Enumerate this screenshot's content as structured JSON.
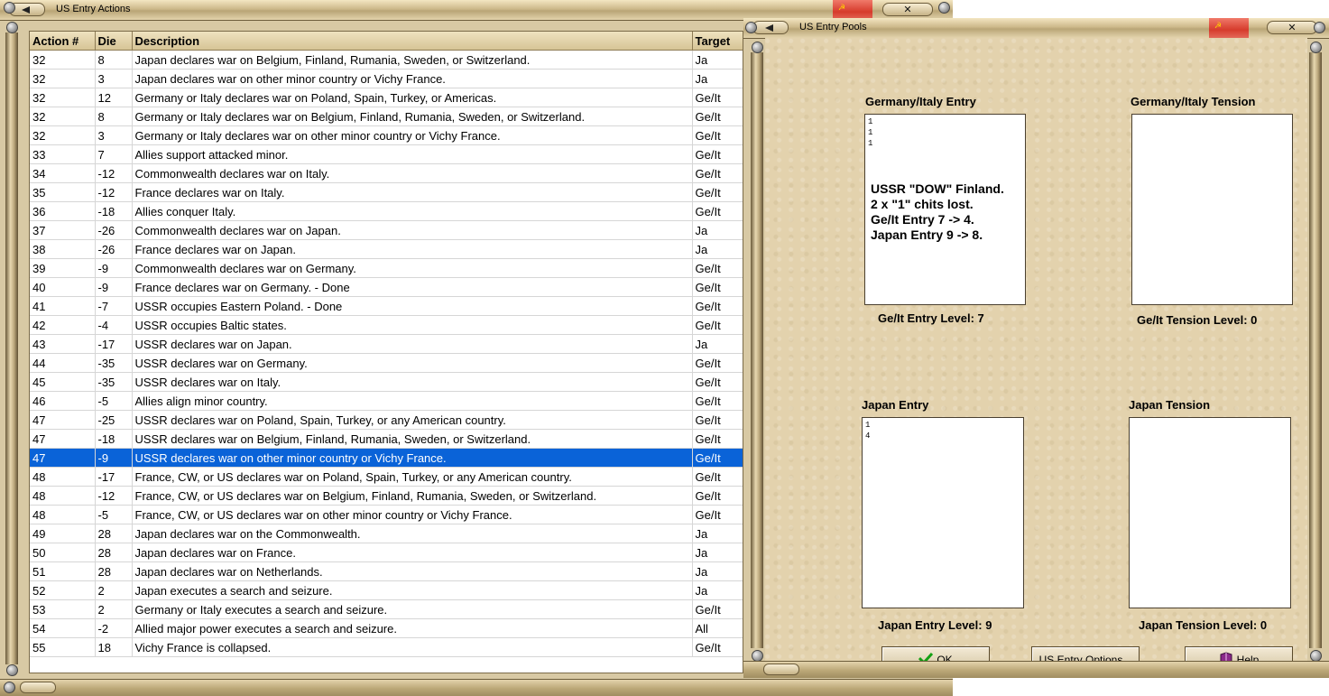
{
  "actions_window": {
    "title": "US Entry Actions",
    "columns": [
      "Action #",
      "Die",
      "Description",
      "Target"
    ],
    "selected_row": 21,
    "rows": [
      [
        "32",
        "8",
        "Japan declares war on Belgium, Finland, Rumania, Sweden, or Switzerland.",
        "Ja"
      ],
      [
        "32",
        "3",
        "Japan declares war on other minor country or Vichy France.",
        "Ja"
      ],
      [
        "32",
        "12",
        "Germany or Italy declares war on Poland, Spain, Turkey, or Americas.",
        "Ge/It"
      ],
      [
        "32",
        "8",
        "Germany or Italy declares war on Belgium, Finland, Rumania, Sweden, or Switzerland.",
        "Ge/It"
      ],
      [
        "32",
        "3",
        "Germany or Italy declares war on other minor country or Vichy France.",
        "Ge/It"
      ],
      [
        "33",
        "7",
        "Allies support attacked minor.",
        "Ge/It"
      ],
      [
        "34",
        "-12",
        "Commonwealth declares war on Italy.",
        "Ge/It"
      ],
      [
        "35",
        "-12",
        "France declares war on Italy.",
        "Ge/It"
      ],
      [
        "36",
        "-18",
        "Allies conquer Italy.",
        "Ge/It"
      ],
      [
        "37",
        "-26",
        "Commonwealth declares war on Japan.",
        "Ja"
      ],
      [
        "38",
        "-26",
        "France declares war on Japan.",
        "Ja"
      ],
      [
        "39",
        "-9",
        "Commonwealth declares war on Germany.",
        "Ge/It"
      ],
      [
        "40",
        "-9",
        "France declares war on Germany. - Done",
        "Ge/It"
      ],
      [
        "41",
        "-7",
        "USSR occupies Eastern Poland. - Done",
        "Ge/It"
      ],
      [
        "42",
        "-4",
        "USSR occupies Baltic states.",
        "Ge/It"
      ],
      [
        "43",
        "-17",
        "USSR declares war on Japan.",
        "Ja"
      ],
      [
        "44",
        "-35",
        "USSR declares war on Germany.",
        "Ge/It"
      ],
      [
        "45",
        "-35",
        "USSR declares war on Italy.",
        "Ge/It"
      ],
      [
        "46",
        "-5",
        "Allies align minor country.",
        "Ge/It"
      ],
      [
        "47",
        "-25",
        "USSR declares war on Poland, Spain, Turkey, or any American country.",
        "Ge/It"
      ],
      [
        "47",
        "-18",
        "USSR declares war on Belgium, Finland, Rumania, Sweden, or Switzerland.",
        "Ge/It"
      ],
      [
        "47",
        "-9",
        "USSR declares war on other minor country or Vichy France.",
        "Ge/It"
      ],
      [
        "48",
        "-17",
        "France, CW, or US declares war on Poland, Spain, Turkey, or any American country.",
        "Ge/It"
      ],
      [
        "48",
        "-12",
        "France, CW, or US declares war on Belgium, Finland, Rumania, Sweden, or Switzerland.",
        "Ge/It"
      ],
      [
        "48",
        "-5",
        "France, CW, or US declares war on other minor country or Vichy France.",
        "Ge/It"
      ],
      [
        "49",
        "28",
        "Japan declares war on the Commonwealth.",
        "Ja"
      ],
      [
        "50",
        "28",
        "Japan declares war on France.",
        "Ja"
      ],
      [
        "51",
        "28",
        "Japan declares war on Netherlands.",
        "Ja"
      ],
      [
        "52",
        "2",
        "Japan executes a search and seizure.",
        "Ja"
      ],
      [
        "53",
        "2",
        "Germany or Italy executes a search and seizure.",
        "Ge/It"
      ],
      [
        "54",
        "-2",
        "Allied major power executes a search and seizure.",
        "All"
      ],
      [
        "55",
        "18",
        "Vichy France is collapsed.",
        "Ge/It"
      ]
    ]
  },
  "pools_window": {
    "title": "US Entry Pools",
    "germany_italy_entry": {
      "label": "Germany/Italy Entry",
      "chits": [
        "1",
        "1",
        "1"
      ],
      "note": [
        "USSR \"DOW\" Finland.",
        "2 x \"1\" chits lost.",
        "Ge/It Entry 7 -> 4.",
        "Japan Entry 9 -> 8."
      ],
      "level_text": "Ge/It Entry Level: 7"
    },
    "germany_italy_tension": {
      "label": "Germany/Italy Tension",
      "chits": [],
      "level_text": "Ge/It Tension Level: 0"
    },
    "japan_entry": {
      "label": "Japan Entry",
      "chits": [
        "1",
        "4"
      ],
      "level_text": "Japan Entry Level: 9"
    },
    "japan_tension": {
      "label": "Japan Tension",
      "chits": [],
      "level_text": "Japan Tension Level: 0"
    },
    "buttons": {
      "ok": "OK",
      "options": "US Entry Options...",
      "help": "Help"
    }
  },
  "colors": {
    "selection": "#0a63d8",
    "parchment": "#e3d2ad",
    "title_red": "#d63b2c"
  },
  "icons": {
    "ok": "green-check-icon",
    "help": "book-icon",
    "close": "close-x-icon",
    "title_menu": "left-triangle-icon"
  }
}
